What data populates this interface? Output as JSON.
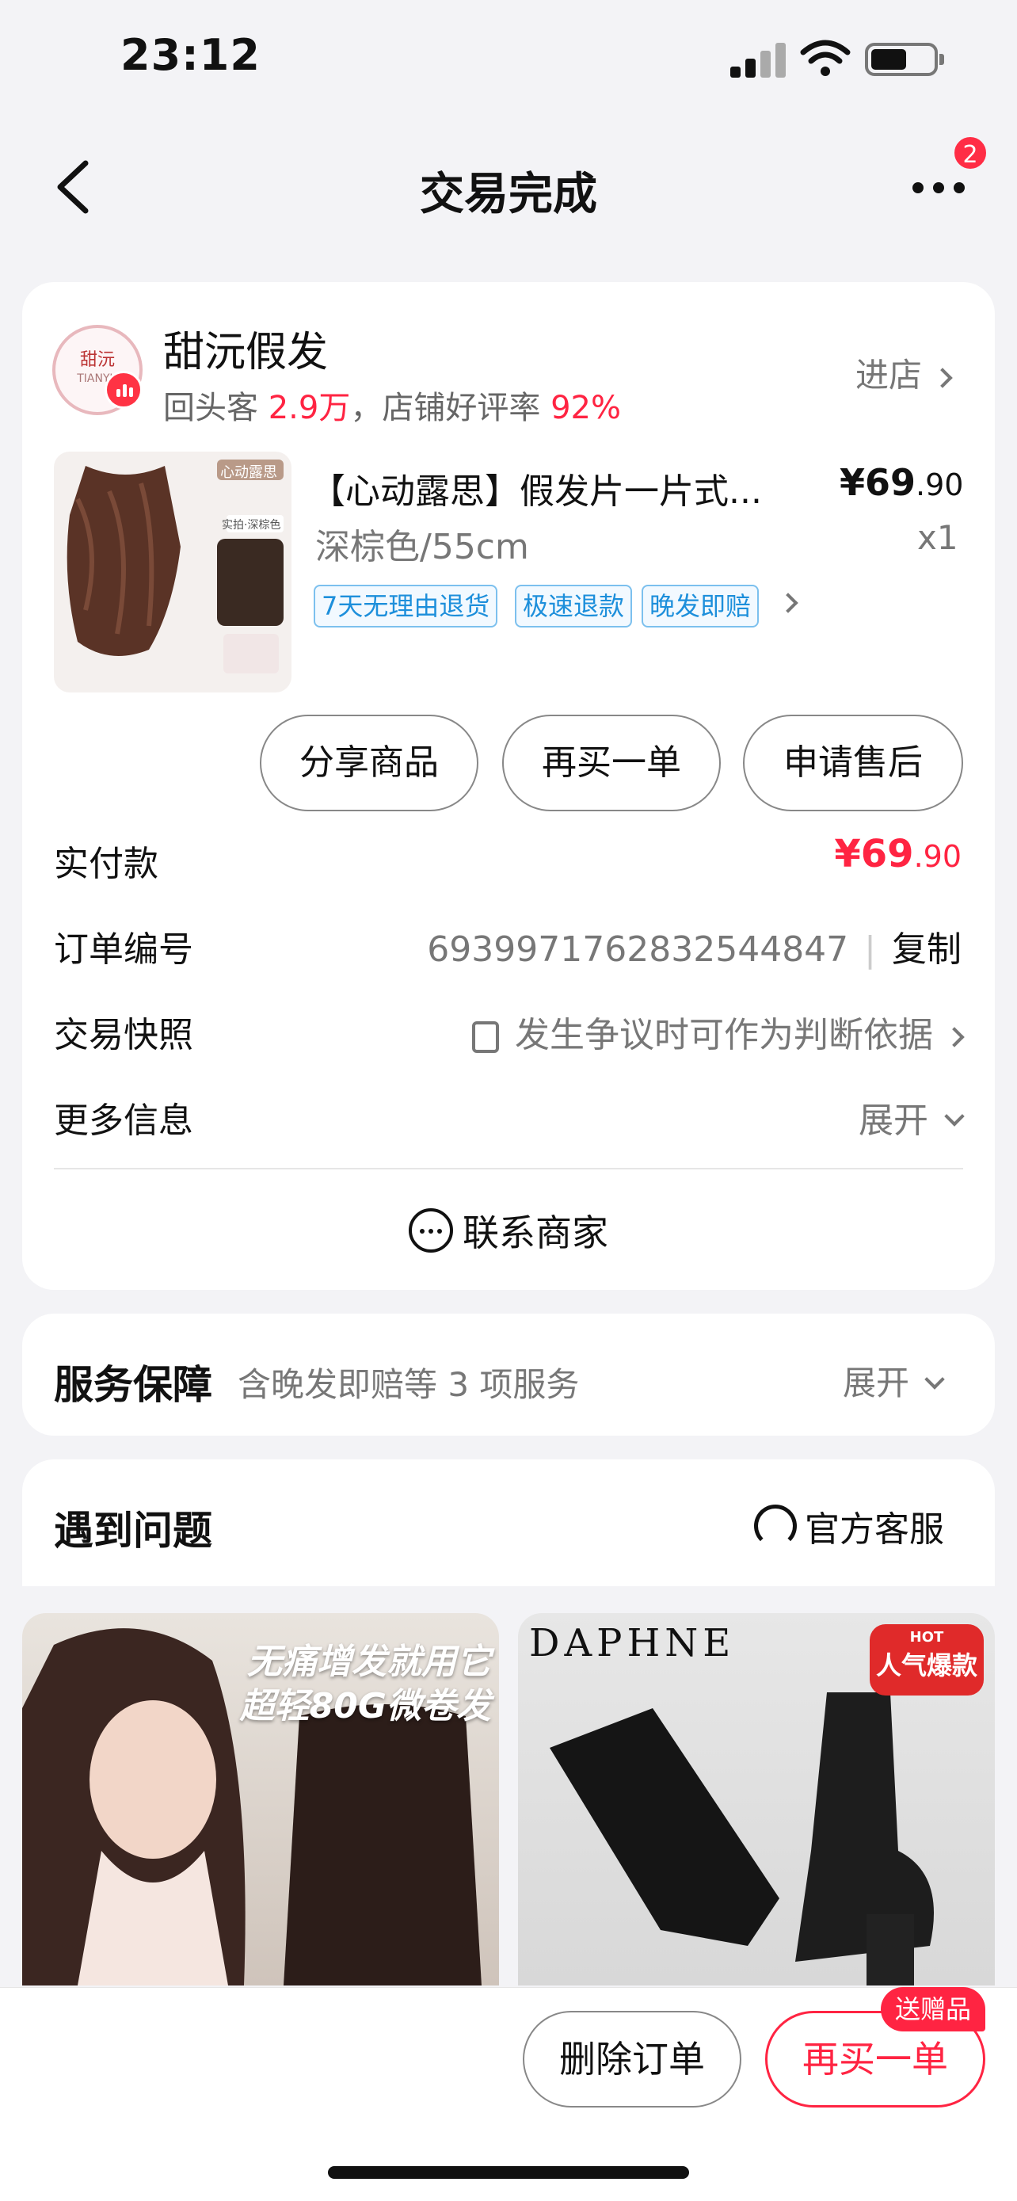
{
  "status": {
    "time": "23:12"
  },
  "nav": {
    "title": "交易完成",
    "badge": "2"
  },
  "shop": {
    "logo_text": "甜沅",
    "logo_sub": "TIANYU",
    "name": "甜沅假发",
    "sub_prefix": "回头客",
    "repeat": "2.9万",
    "sub_mid": "，店铺好评率",
    "rating": "92%",
    "enter": "进店"
  },
  "product": {
    "title": "【心动露思】假发片一片式...",
    "price_main": "¥69",
    "price_dec": ".90",
    "spec": "深棕色/55cm",
    "qty": "x1",
    "tags": [
      "7天无理由退货",
      "极速退款",
      "晚发即赔"
    ],
    "image_labels": [
      "心动露思",
      "实拍·深棕色"
    ]
  },
  "actions": {
    "share": "分享商品",
    "rebuy": "再买一单",
    "aftersale": "申请售后"
  },
  "rows": {
    "paid_label": "实付款",
    "paid_main": "¥69",
    "paid_dec": ".90",
    "order_label": "订单编号",
    "order_no": "6939971762832544847",
    "copy": "复制",
    "snapshot_label": "交易快照",
    "snapshot_value": "发生争议时可作为判断依据",
    "more_label": "更多信息",
    "more_value": "展开"
  },
  "contact": "联系商家",
  "service": {
    "title": "服务保障",
    "sub": "含晚发即赔等 3 项服务",
    "expand": "展开"
  },
  "problem": {
    "title": "遇到问题",
    "cs": "官方客服"
  },
  "feed": {
    "item1_caption_1": "无痛增发就用它",
    "item1_caption_2": "超轻80G微卷发",
    "item2_brand": "DAPHNE",
    "item2_hot_top": "HOT",
    "item2_hot": "人气爆款"
  },
  "bottom": {
    "delete": "删除订单",
    "rebuy": "再买一单",
    "gift": "送赠品"
  }
}
